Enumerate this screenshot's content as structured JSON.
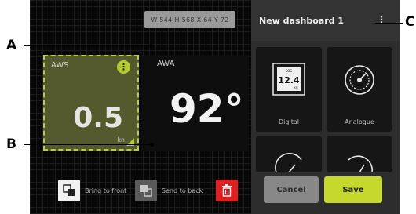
{
  "callouts": {
    "a": "A",
    "b": "B",
    "c": "C"
  },
  "editor": {
    "dimensions": "W 544  H 568  X 64  Y 72",
    "widgets": [
      {
        "label": "AWS",
        "value": "0.5",
        "unit": "kn"
      },
      {
        "label": "AWA",
        "value": "92°"
      }
    ],
    "actions": {
      "bring_to_front": "Bring to front",
      "send_to_back": "Send to back"
    }
  },
  "panel": {
    "title": "New dashboard 1",
    "tiles": [
      {
        "name": "Digital",
        "icon": "digital-display-icon",
        "preview_value": "12.4",
        "preview_top": "SOG",
        "preview_unit": "KN"
      },
      {
        "name": "Analogue",
        "icon": "analogue-gauge-icon"
      }
    ],
    "cancel_label": "Cancel",
    "save_label": "Save"
  },
  "colors": {
    "accent": "#c6d82c",
    "delete": "#e02020",
    "panel": "#2d2d2d"
  }
}
